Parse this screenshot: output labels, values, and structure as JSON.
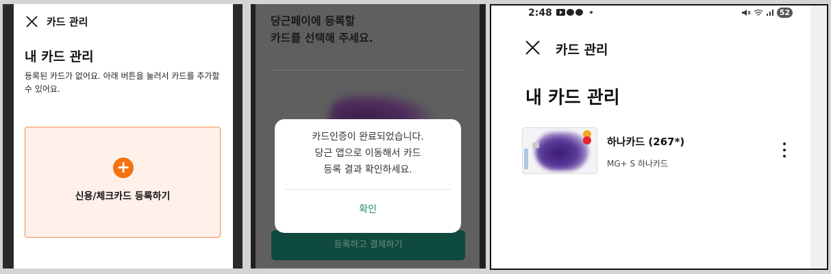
{
  "panel1": {
    "close_icon": "close-icon",
    "title": "카드 관리",
    "heading": "내 카드 관리",
    "description": "등록된 카드가 없어요. 아래 버튼을 눌러서 카드를 추가할 수 있어요.",
    "add_icon": "plus-icon",
    "add_label": "신용/체크카드 등록하기",
    "accent_color": "#f5720f"
  },
  "panel2": {
    "heading_line1": "당근페이에 등록할",
    "heading_line2": "카드를 선택해 주세요.",
    "dialog": {
      "message_line1": "카드인증이 완료되었습니다.",
      "message_line2": "당근 앱으로 이동해서 카드",
      "message_line3": "등록 결과 확인하세요.",
      "confirm_label": "확인"
    },
    "pay_button_label": "등록하고 결제하기",
    "button_color": "#0f4a3e"
  },
  "panel3": {
    "status_time": "2:48",
    "battery": "52",
    "close_icon": "close-icon",
    "title": "카드 관리",
    "heading": "내 카드 관리",
    "card": {
      "name": "하나카드 (267*)",
      "product": "MG+ S 하나카드",
      "menu_icon": "more-vertical-icon"
    }
  }
}
